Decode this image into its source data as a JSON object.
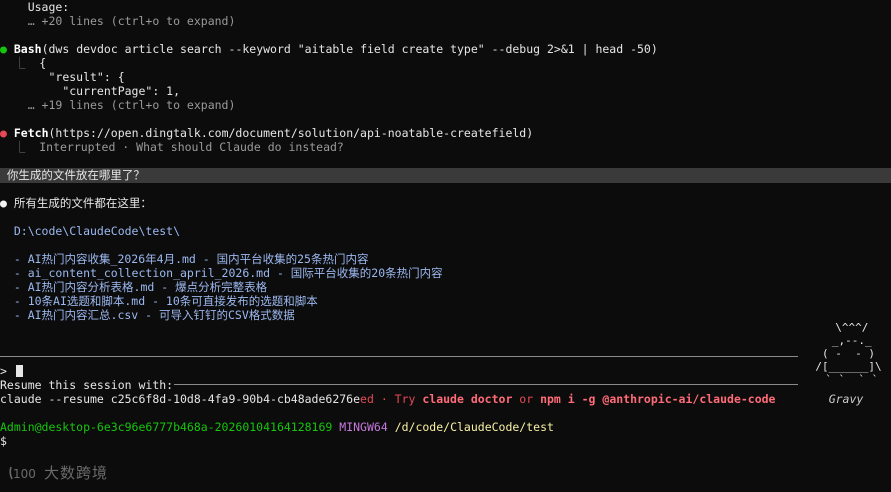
{
  "lines": {
    "usage": "    Usage:",
    "usage_more": "    … +20 lines (ctrl+o to expand)",
    "bash_tool": "Bash",
    "bash_args": "(dws devdoc article search --keyword \"aitable field create type\" --debug 2>&1 | head -50)",
    "bash_out1": "{",
    "bash_out2": "  \"result\": {",
    "bash_out3": "    \"currentPage\": 1,",
    "bash_more": "    … +19 lines (ctrl+o to expand)",
    "fetch_tool": "Fetch",
    "fetch_args": "(https://open.dingtalk.com/document/solution/api-noatable-createfield)",
    "fetch_status": "Interrupted · What should Claude do instead?",
    "user_question": " 你生成的文件放在哪里了？",
    "answer_intro": "所有生成的文件都在这里：",
    "answer_path": "  D:\\code\\ClaudeCode\\test\\",
    "files": [
      "  - AI热门内容收集_2026年4月.md - 国内平台收集的25条热门内容",
      "  - ai_content_collection_april_2026.md - 国际平台收集的20条热门内容",
      "  - AI热门内容分析表格.md - 爆点分析完整表格",
      "  - 10条AI选题和脚本.md - 10条可直接发布的选题和脚本",
      "  - AI热门内容汇总.csv - 可导入钉钉的CSV格式数据"
    ],
    "prompt_symbol": ">",
    "resume_label": "Resume this session with:",
    "resume_cmd": "claude --resume c25c6f8d-10d8-4fa9-90b4-cb48ade6276e",
    "ed_suffix": "ed",
    "try_text": " · Try ",
    "try_cmd1": "claude doctor",
    "try_or": " or ",
    "try_cmd2": "npm i -g @anthropic-ai/claude-code",
    "ps1_user": "Admin@desktop-6e3c96e6777b468a-20260104164128169",
    "ps1_env": "MINGW64",
    "ps1_path": "/d/code/ClaudeCode/test",
    "shell_prompt": "$"
  },
  "icons": {
    "bullet": "●",
    "tree_branch": "⎿"
  },
  "mascot": {
    "art": " \\^^^/\n _,--._\n( -  - )\n/[______]\\\n ` `  ` `",
    "name": "Gravy"
  },
  "watermark": {
    "text": "大数跨境"
  },
  "colors": {
    "background": "#0c0c0c",
    "success_dot": "#16c60c",
    "error_dot": "#e74856",
    "path_blue": "#9cb8f0",
    "prompt_green": "#16c60c",
    "prompt_magenta": "#c678dd",
    "prompt_yellow": "#f9f1a5"
  }
}
